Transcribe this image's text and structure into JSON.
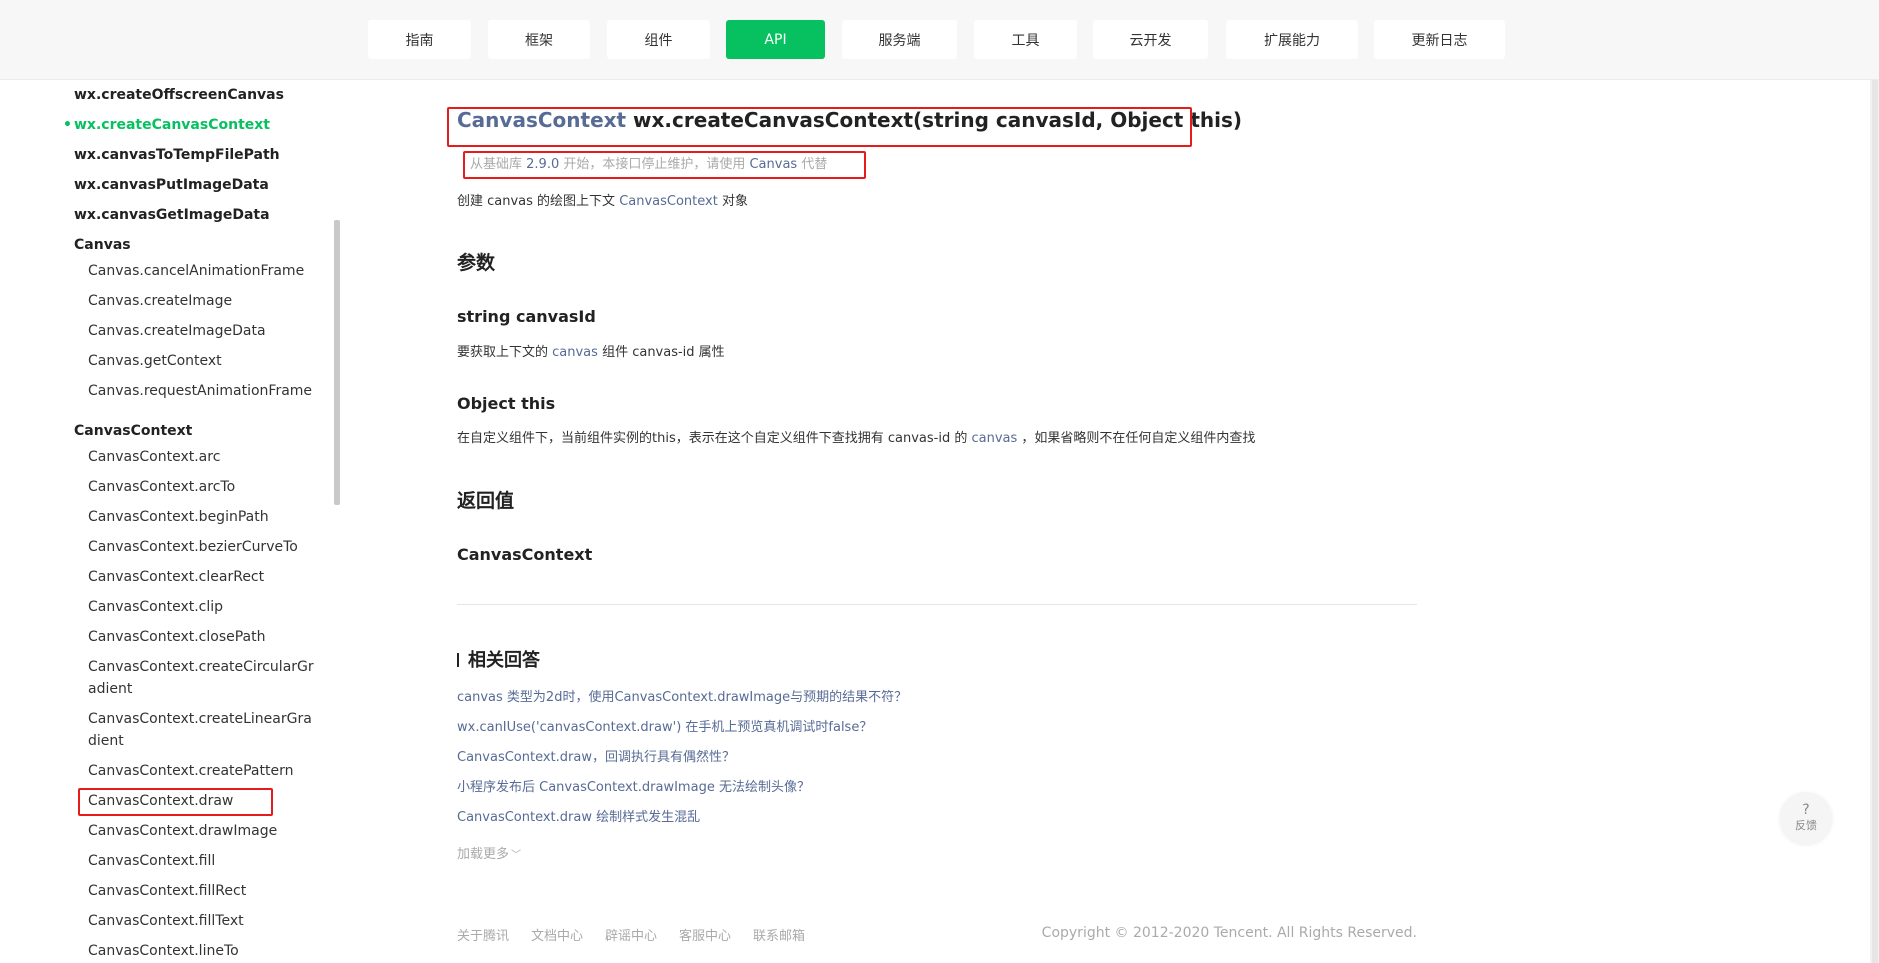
{
  "nav": {
    "tabs": [
      "指南",
      "框架",
      "组件",
      "API",
      "服务端",
      "工具",
      "云开发",
      "扩展能力",
      "更新日志"
    ],
    "active": "API"
  },
  "sidebar": {
    "items": [
      "wx.createOffscreenCanvas",
      "wx.createCanvasContext",
      "wx.canvasToTempFilePath",
      "wx.canvasPutImageData",
      "wx.canvasGetImageData"
    ],
    "canvas_heading": "Canvas",
    "canvas_items": [
      "Canvas.cancelAnimationFrame",
      "Canvas.createImage",
      "Canvas.createImageData",
      "Canvas.getContext",
      "Canvas.requestAnimationFrame"
    ],
    "ctx_heading": "CanvasContext",
    "ctx_items": [
      "CanvasContext.arc",
      "CanvasContext.arcTo",
      "CanvasContext.beginPath",
      "CanvasContext.bezierCurveTo",
      "CanvasContext.clearRect",
      "CanvasContext.clip",
      "CanvasContext.closePath",
      "CanvasContext.createCircularGradient",
      "CanvasContext.createLinearGradient",
      "CanvasContext.createPattern",
      "CanvasContext.draw",
      "CanvasContext.drawImage",
      "CanvasContext.fill",
      "CanvasContext.fillRect",
      "CanvasContext.fillText",
      "CanvasContext.lineTo"
    ],
    "ctx_wrap": {
      "circular_1": "CanvasContext.createCircularGr",
      "circular_2": "adient",
      "linear_1": "CanvasContext.createLinearGra",
      "linear_2": "dient"
    }
  },
  "main": {
    "title_type": "CanvasContext",
    "title_sig": " wx.createCanvasContext(string canvasId, Object this)",
    "deprecated_prefix": "从基础库 ",
    "deprecated_version": "2.9.0",
    "deprecated_mid": " 开始，本接口停止维护，请使用 ",
    "deprecated_link": "Canvas",
    "deprecated_suffix": " 代替",
    "desc_prefix": "创建 canvas 的绘图上下文 ",
    "desc_link": "CanvasContext",
    "desc_suffix": " 对象",
    "params_heading": "参数",
    "param1_name": "string canvasId",
    "param1_prefix": "要获取上下文的 ",
    "param1_link": "canvas",
    "param1_suffix": " 组件 canvas-id 属性",
    "param2_name": "Object this",
    "param2_prefix": "在自定义组件下，当前组件实例的this，表示在这个自定义组件下查找拥有 canvas-id 的 ",
    "param2_link": "canvas",
    "param2_suffix": " ，如果省略则不在任何自定义组件内查找",
    "return_heading": "返回值",
    "return_type": "CanvasContext",
    "related_heading": "相关回答",
    "related": [
      "canvas 类型为2d时，使用CanvasContext.drawImage与预期的结果不符？",
      "wx.canIUse('canvasContext.draw') 在手机上预览真机调试时false？",
      "CanvasContext.draw，回调执行具有偶然性？",
      "小程序发布后 CanvasContext.drawImage 无法绘制头像？",
      "CanvasContext.draw 绘制样式发生混乱"
    ],
    "load_more": "加载更多"
  },
  "footer": {
    "links": [
      "关于腾讯",
      "文档中心",
      "辟谣中心",
      "客服中心",
      "联系邮箱"
    ],
    "copyright": "Copyright © 2012-2020 Tencent. All Rights Reserved."
  },
  "feedback": {
    "q": "?",
    "label": "反馈"
  },
  "colors": {
    "accent": "#07c160",
    "link": "#576b95",
    "annotation": "#e41c1c"
  }
}
